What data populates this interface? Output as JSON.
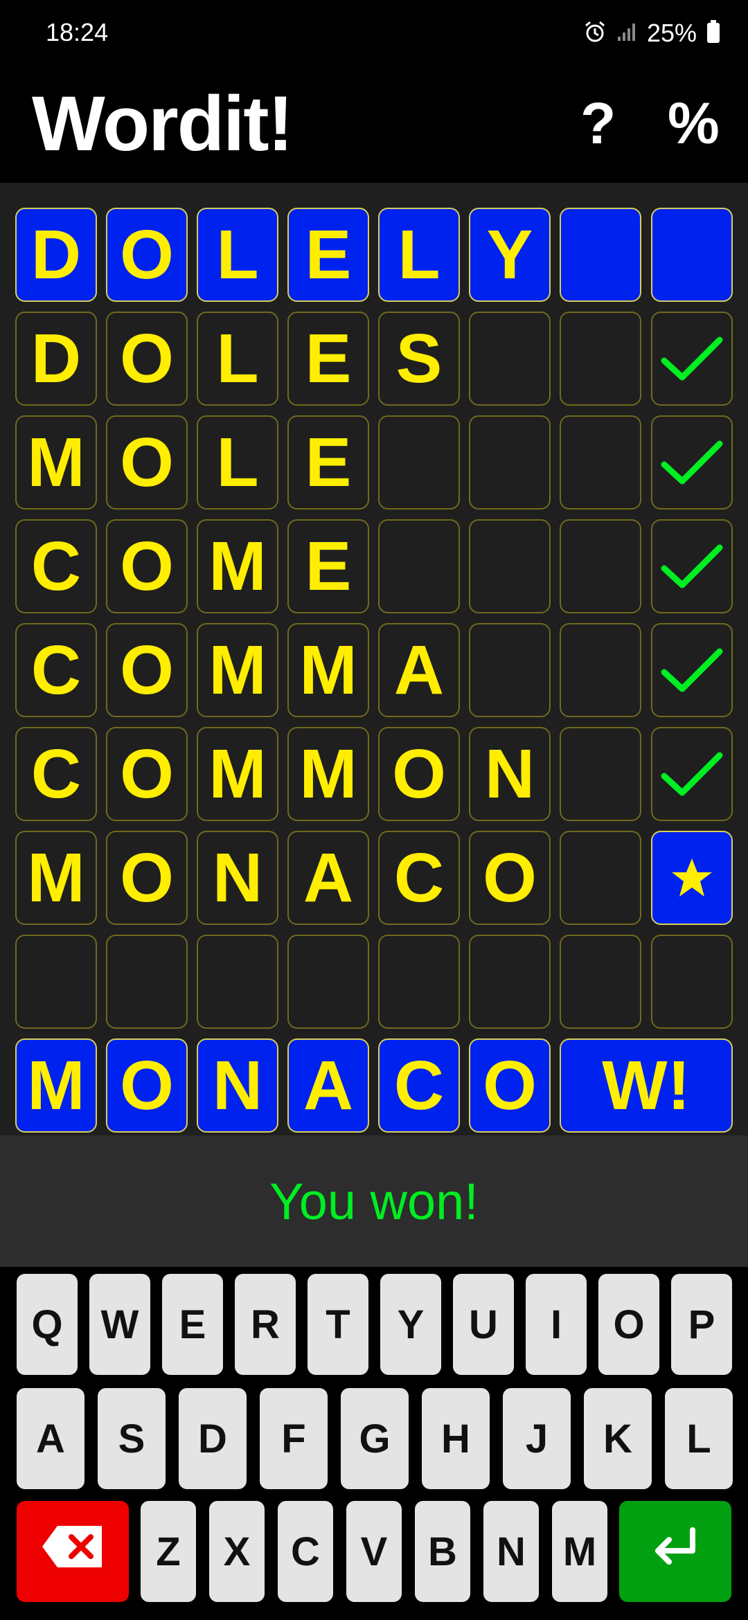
{
  "status_bar": {
    "time": "18:24",
    "battery_percent": "25%"
  },
  "header": {
    "title": "Wordit!",
    "help_label": "?",
    "stats_label": "%"
  },
  "board": {
    "target_row": [
      "D",
      "O",
      "L",
      "E",
      "L",
      "Y",
      "",
      ""
    ],
    "guess_rows": [
      {
        "letters": [
          "D",
          "O",
          "L",
          "E",
          "S",
          "",
          ""
        ],
        "result": "check"
      },
      {
        "letters": [
          "M",
          "O",
          "L",
          "E",
          "",
          "",
          ""
        ],
        "result": "check"
      },
      {
        "letters": [
          "C",
          "O",
          "M",
          "E",
          "",
          "",
          ""
        ],
        "result": "check"
      },
      {
        "letters": [
          "C",
          "O",
          "M",
          "M",
          "A",
          "",
          ""
        ],
        "result": "check"
      },
      {
        "letters": [
          "C",
          "O",
          "M",
          "M",
          "O",
          "N",
          ""
        ],
        "result": "check"
      },
      {
        "letters": [
          "M",
          "O",
          "N",
          "A",
          "C",
          "O",
          ""
        ],
        "result": "star"
      },
      {
        "letters": [
          "",
          "",
          "",
          "",
          "",
          "",
          ""
        ],
        "result": ""
      }
    ],
    "answer_row": [
      "M",
      "O",
      "N",
      "A",
      "C",
      "O"
    ],
    "win_label": "W!"
  },
  "message": "You won!",
  "keyboard": {
    "row1": [
      "Q",
      "W",
      "E",
      "R",
      "T",
      "Y",
      "U",
      "I",
      "O",
      "P"
    ],
    "row2": [
      "A",
      "S",
      "D",
      "F",
      "G",
      "H",
      "J",
      "K",
      "L"
    ],
    "row3": [
      "Z",
      "X",
      "C",
      "V",
      "B",
      "N",
      "M"
    ]
  },
  "colors": {
    "tile_blue": "#0022ee",
    "letter_yellow": "#ffee00",
    "check_green": "#00ee22",
    "delete_red": "#ee0000",
    "enter_green": "#00a010"
  }
}
